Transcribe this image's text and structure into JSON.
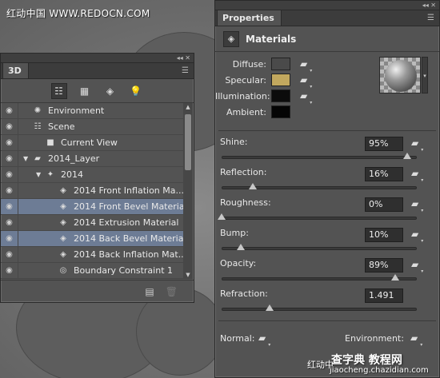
{
  "watermark": {
    "top": "红动中国 WWW.REDOCN.COM",
    "bottom_left": "红动中",
    "bottom_logo": "查字典 教程网",
    "bottom_url": "jiaocheng.chazidian.com"
  },
  "panel3d": {
    "tab": "3D",
    "menu_glyph": "☰",
    "collapse_glyph": "◂◂ ✕",
    "filters": [
      {
        "icon": "scene-filter-icon",
        "glyph": "☷",
        "active": true
      },
      {
        "icon": "mesh-filter-icon",
        "glyph": "▦",
        "active": false
      },
      {
        "icon": "material-filter-icon",
        "glyph": "◈",
        "active": false
      },
      {
        "icon": "light-filter-icon",
        "glyph": "💡",
        "active": false
      }
    ],
    "rows": [
      {
        "label": "Environment",
        "indent": 0,
        "toggle": "",
        "icon": "✺",
        "icon_name": "environment-icon",
        "eye": true,
        "selected": false
      },
      {
        "label": "Scene",
        "indent": 0,
        "toggle": "",
        "icon": "☷",
        "icon_name": "scene-icon",
        "eye": true,
        "selected": false
      },
      {
        "label": "Current View",
        "indent": 1,
        "toggle": "",
        "icon": "■",
        "icon_name": "camera-icon",
        "eye": true,
        "selected": false
      },
      {
        "label": "2014_Layer",
        "indent": 0,
        "toggle": "▼",
        "icon": "▰",
        "icon_name": "layer-folder-icon",
        "eye": true,
        "selected": false
      },
      {
        "label": "2014",
        "indent": 1,
        "toggle": "▼",
        "icon": "✦",
        "icon_name": "mesh-icon",
        "eye": true,
        "selected": false
      },
      {
        "label": "2014 Front Inflation Ma...",
        "indent": 2,
        "toggle": "",
        "icon": "◈",
        "icon_name": "material-icon",
        "eye": true,
        "selected": false
      },
      {
        "label": "2014 Front Bevel Material",
        "indent": 2,
        "toggle": "",
        "icon": "◈",
        "icon_name": "material-icon",
        "eye": true,
        "selected": true
      },
      {
        "label": "2014 Extrusion Material",
        "indent": 2,
        "toggle": "",
        "icon": "◈",
        "icon_name": "material-icon",
        "eye": true,
        "selected": false
      },
      {
        "label": "2014 Back Bevel Material",
        "indent": 2,
        "toggle": "",
        "icon": "◈",
        "icon_name": "material-icon",
        "eye": true,
        "selected": true
      },
      {
        "label": "2014 Back Inflation Mat...",
        "indent": 2,
        "toggle": "",
        "icon": "◈",
        "icon_name": "material-icon",
        "eye": true,
        "selected": false
      },
      {
        "label": "Boundary Constraint 1",
        "indent": 2,
        "toggle": "",
        "icon": "◎",
        "icon_name": "constraint-icon",
        "eye": true,
        "selected": false
      }
    ],
    "footer": {
      "new_glyph": "▤",
      "delete_glyph": "🗑"
    }
  },
  "properties": {
    "tab": "Properties",
    "menu_glyph": "☰",
    "collapse_glyph": "◂◂ ✕",
    "section_title": "Materials",
    "colors": [
      {
        "label": "Diffuse:",
        "hex": "#4a4a4a",
        "has_folder": true
      },
      {
        "label": "Specular:",
        "hex": "#c2a85e",
        "has_folder": true
      },
      {
        "label": "Illumination:",
        "hex": "#0c0c0c",
        "has_folder": true
      },
      {
        "label": "Ambient:",
        "hex": "#050505",
        "has_folder": false
      }
    ],
    "sliders": [
      {
        "label": "Shine:",
        "value": "95%",
        "fraction": 0.95,
        "has_folder": true
      },
      {
        "label": "Reflection:",
        "value": "16%",
        "fraction": 0.16,
        "has_folder": true
      },
      {
        "label": "Roughness:",
        "value": "0%",
        "fraction": 0.0,
        "has_folder": true
      },
      {
        "label": "Bump:",
        "value": "10%",
        "fraction": 0.1,
        "has_folder": true
      },
      {
        "label": "Opacity:",
        "value": "89%",
        "fraction": 0.89,
        "has_folder": true
      },
      {
        "label": "Refraction:",
        "value": "1.491",
        "fraction": 0.245,
        "has_folder": false
      }
    ],
    "normal_label": "Normal:",
    "environment_label": "Environment:"
  }
}
